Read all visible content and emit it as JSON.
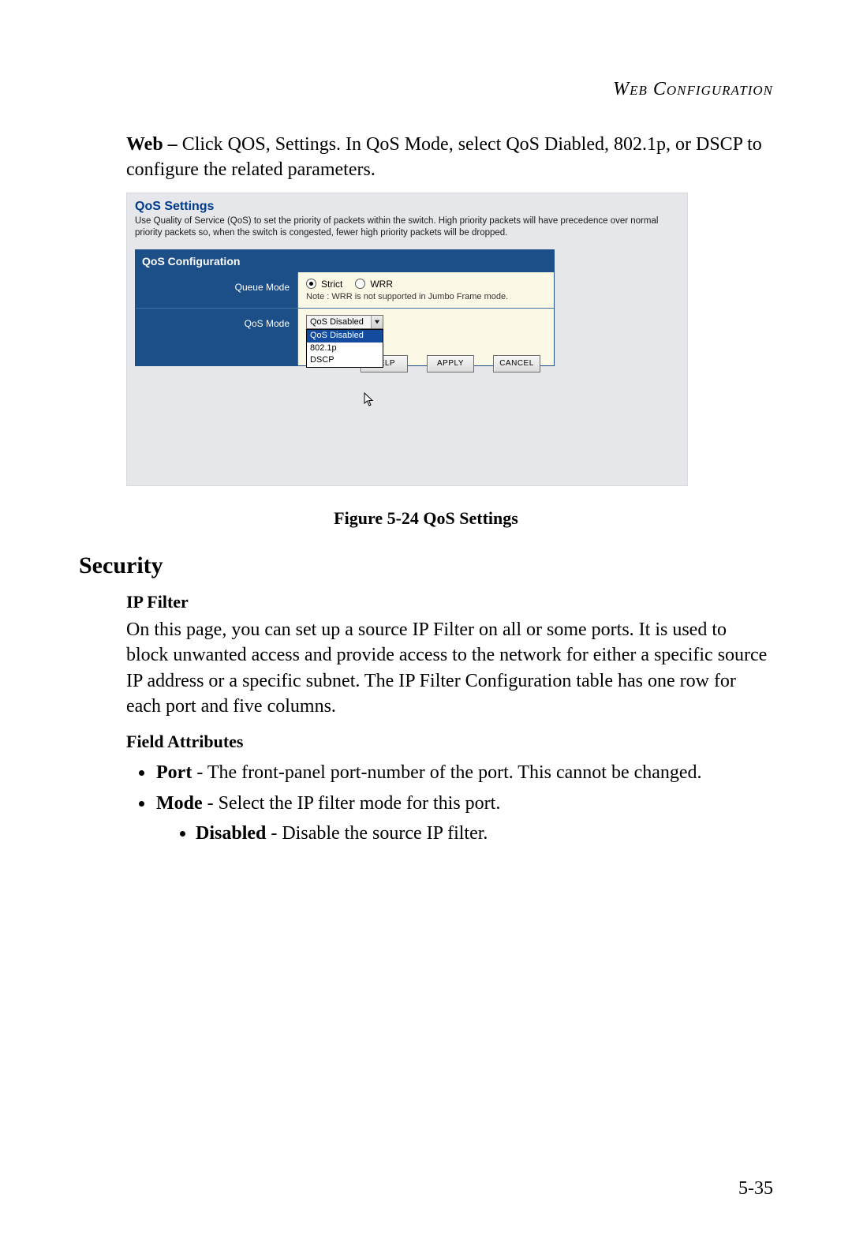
{
  "header": {
    "right": "Web Configuration"
  },
  "intro": {
    "lead": "Web –",
    "rest": " Click QOS, Settings. In QoS Mode, select QoS Diabled, 802.1p, or DSCP to configure the related parameters."
  },
  "screenshot": {
    "title": "QoS Settings",
    "description": "Use Quality of Service (QoS) to set the priority of packets within the switch. High priority packets will have precedence over normal priority packets so, when the switch is congested, fewer high priority packets will be dropped.",
    "section_header": "QoS Configuration",
    "rows": {
      "queue_mode": {
        "label": "Queue Mode",
        "opt_strict": "Strict",
        "opt_wrr": "WRR",
        "selected": "Strict",
        "note": "Note : WRR is not supported in Jumbo Frame mode."
      },
      "qos_mode": {
        "label": "QoS Mode",
        "selected": "QoS Disabled",
        "options": [
          "QoS Disabled",
          "802.1p",
          "DSCP"
        ]
      }
    },
    "buttons": {
      "help": "HELP",
      "apply": "APPLY",
      "cancel": "CANCEL"
    }
  },
  "figure": {
    "caption": "Figure 5-24  QoS Settings"
  },
  "security": {
    "heading": "Security",
    "ipfilter": {
      "title": "IP Filter",
      "text": "On this page, you can set up a source IP Filter on all or some ports. It is used to block unwanted access and provide access to the network for either a specific source IP address or a specific subnet. The IP Filter Configuration table has one row for each port and five columns."
    },
    "field_attributes": {
      "title": "Field Attributes",
      "items": [
        {
          "label": "Port",
          "text": " - The front-panel port-number of the port. This cannot be changed."
        },
        {
          "label": "Mode",
          "text": " - Select the IP filter mode for this port.",
          "sub": [
            {
              "label": "Disabled",
              "text": " - Disable the source IP filter."
            }
          ]
        }
      ]
    }
  },
  "page_number": "5-35"
}
